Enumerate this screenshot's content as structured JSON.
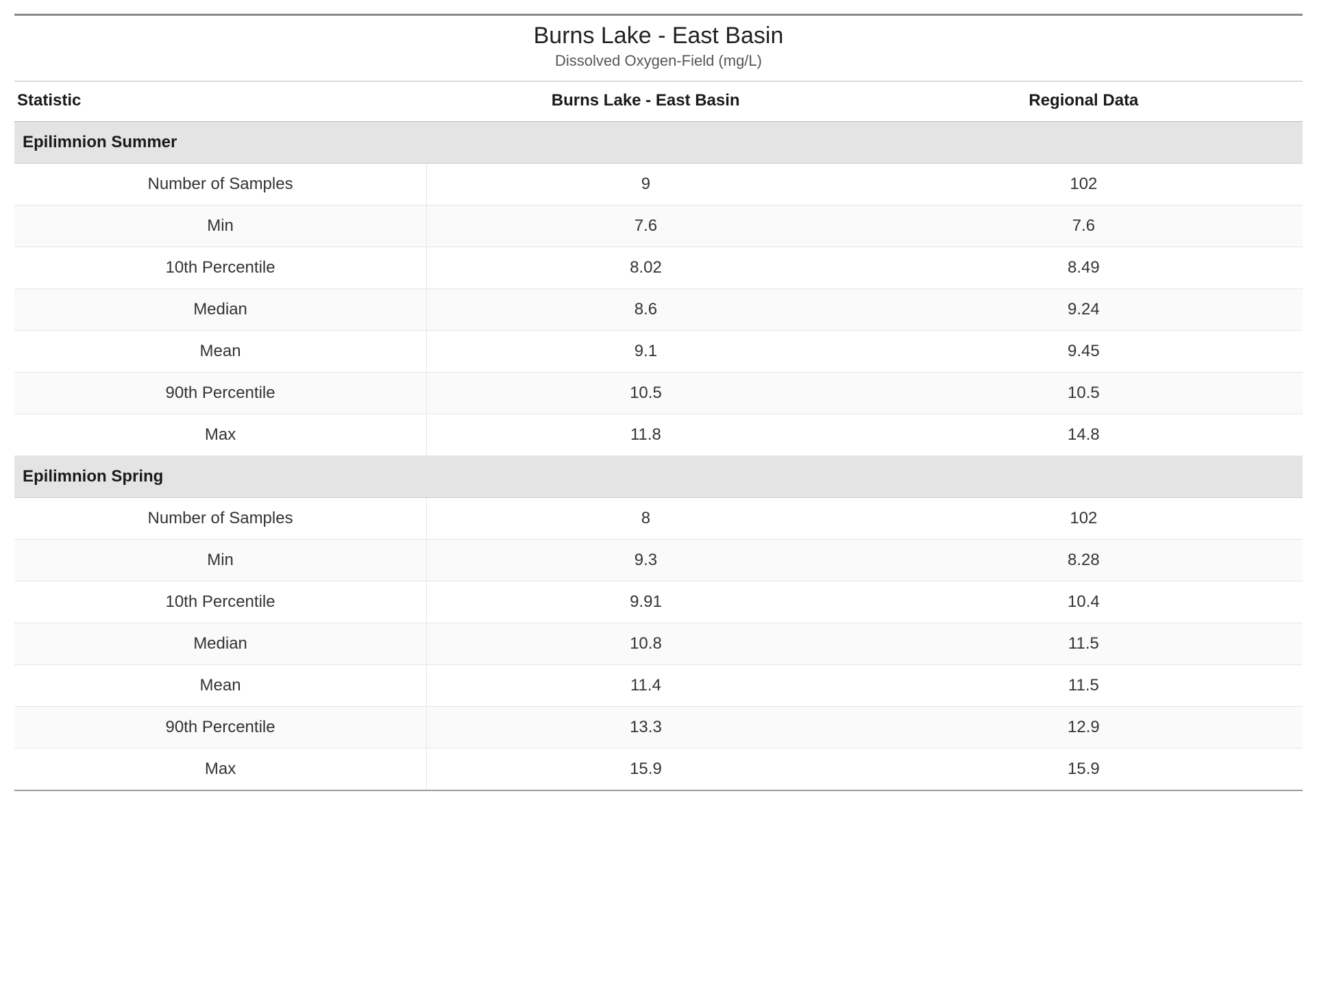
{
  "header": {
    "title": "Burns Lake - East Basin",
    "subtitle": "Dissolved Oxygen-Field (mg/L)"
  },
  "columns": {
    "statistic": "Statistic",
    "site": "Burns Lake - East Basin",
    "regional": "Regional Data"
  },
  "sections": [
    {
      "name": "Epilimnion Summer",
      "rows": [
        {
          "stat": "Number of Samples",
          "site": "9",
          "reg": "102"
        },
        {
          "stat": "Min",
          "site": "7.6",
          "reg": "7.6"
        },
        {
          "stat": "10th Percentile",
          "site": "8.02",
          "reg": "8.49"
        },
        {
          "stat": "Median",
          "site": "8.6",
          "reg": "9.24"
        },
        {
          "stat": "Mean",
          "site": "9.1",
          "reg": "9.45"
        },
        {
          "stat": "90th Percentile",
          "site": "10.5",
          "reg": "10.5"
        },
        {
          "stat": "Max",
          "site": "11.8",
          "reg": "14.8"
        }
      ]
    },
    {
      "name": "Epilimnion Spring",
      "rows": [
        {
          "stat": "Number of Samples",
          "site": "8",
          "reg": "102"
        },
        {
          "stat": "Min",
          "site": "9.3",
          "reg": "8.28"
        },
        {
          "stat": "10th Percentile",
          "site": "9.91",
          "reg": "10.4"
        },
        {
          "stat": "Median",
          "site": "10.8",
          "reg": "11.5"
        },
        {
          "stat": "Mean",
          "site": "11.4",
          "reg": "11.5"
        },
        {
          "stat": "90th Percentile",
          "site": "13.3",
          "reg": "12.9"
        },
        {
          "stat": "Max",
          "site": "15.9",
          "reg": "15.9"
        }
      ]
    }
  ]
}
